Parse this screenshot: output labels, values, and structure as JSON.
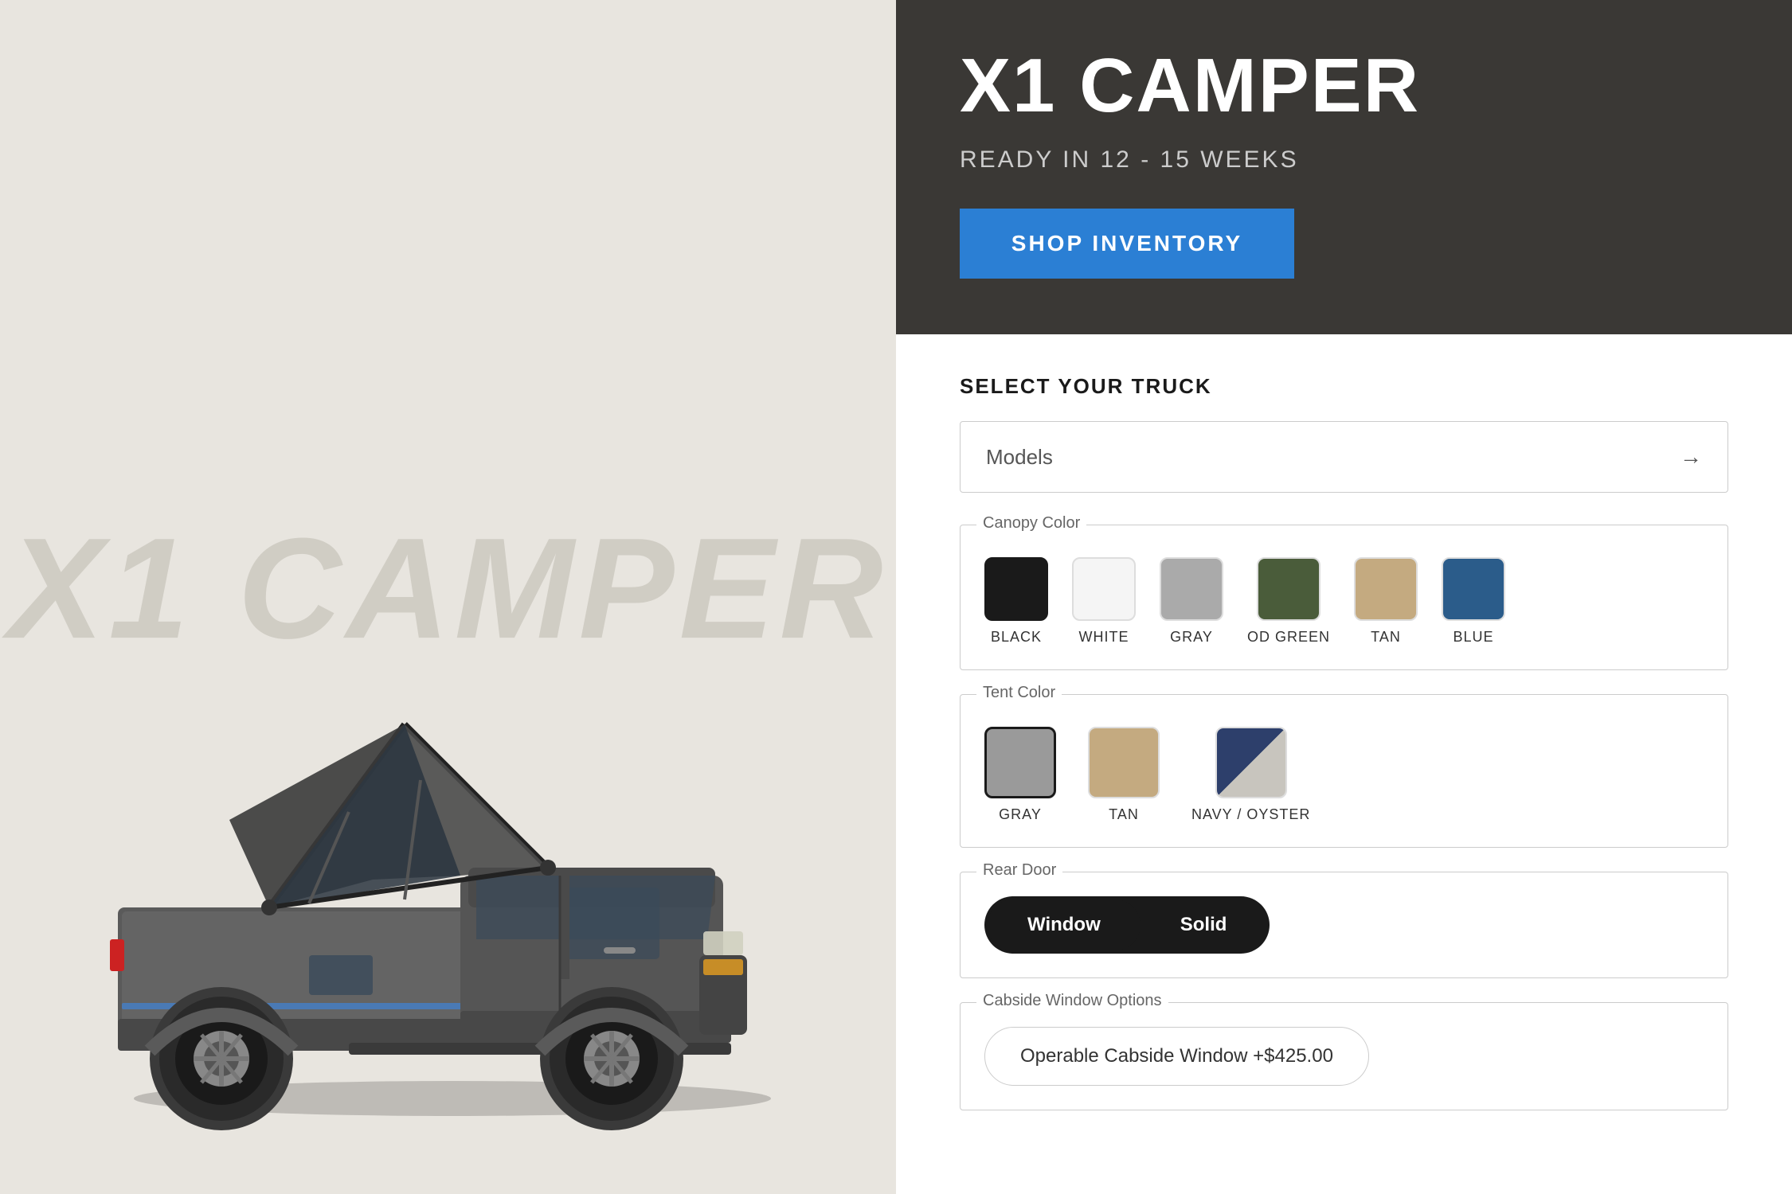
{
  "left": {
    "bg_title": "X1 CAMPER"
  },
  "right": {
    "header": {
      "product_title": "X1 CAMPER",
      "ready_text": "READY IN 12 - 15 WEEKS",
      "shop_button": "SHOP INVENTORY"
    },
    "config": {
      "section_label": "SELECT YOUR TRUCK",
      "models_placeholder": "Models",
      "canopy_color": {
        "group_label": "Canopy Color",
        "swatches": [
          {
            "label": "BLACK",
            "color": "#1a1a1a",
            "selected": true
          },
          {
            "label": "WHITE",
            "color": "#f5f5f5",
            "selected": false
          },
          {
            "label": "GRAY",
            "color": "#aaaaaa",
            "selected": false
          },
          {
            "label": "OD GREEN",
            "color": "#4a5c3a",
            "selected": false
          },
          {
            "label": "TAN",
            "color": "#c4aa80",
            "selected": false
          },
          {
            "label": "BLUE",
            "color": "#2b5c8a",
            "selected": false
          }
        ]
      },
      "tent_color": {
        "group_label": "Tent Color",
        "swatches": [
          {
            "label": "GRAY",
            "color": "#9a9a9a",
            "selected": true
          },
          {
            "label": "TAN",
            "color": "#c4aa80",
            "selected": false
          },
          {
            "label": "NAVY / OYSTER",
            "color": "diagonal",
            "selected": false
          }
        ]
      },
      "rear_door": {
        "group_label": "Rear Door",
        "options": [
          {
            "label": "Window",
            "active": true
          },
          {
            "label": "Solid",
            "active": false
          }
        ]
      },
      "cabside": {
        "group_label": "Cabside Window Options",
        "button_label": "Operable Cabside Window +$425.00"
      }
    }
  }
}
